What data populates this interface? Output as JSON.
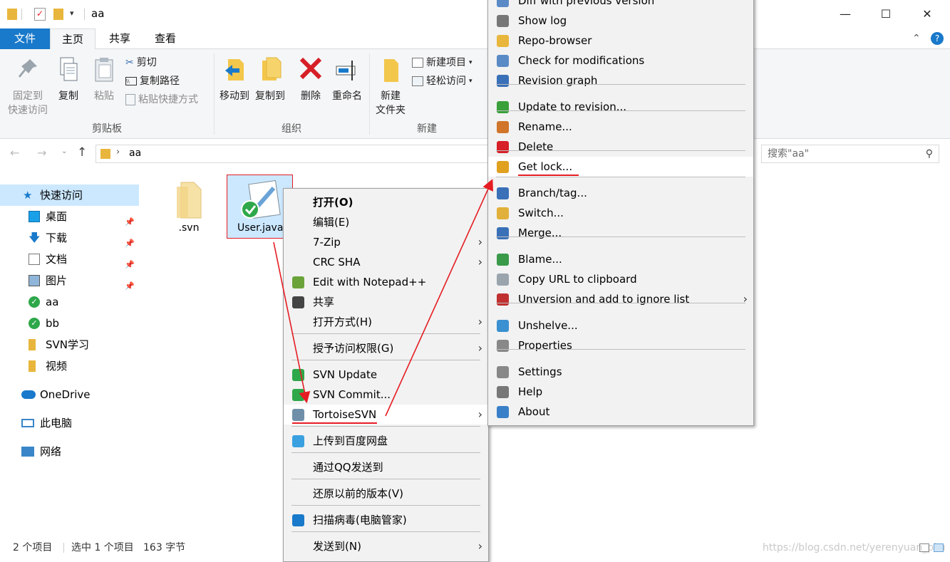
{
  "window": {
    "title": "aa",
    "minimize": "—",
    "maximize": "☐",
    "close": "✕"
  },
  "ribbon_tabs": [
    "文件",
    "主页",
    "共享",
    "查看"
  ],
  "ribbon": {
    "pin": "固定到\n快速访问",
    "pin_l1": "固定到",
    "pin_l2": "快速访问",
    "copy": "复制",
    "paste": "粘贴",
    "cut": "剪切",
    "copy_path": "复制路径",
    "paste_shortcut": "粘贴快捷方式",
    "clipboard_group": "剪贴板",
    "move_to": "移动到",
    "copy_to": "复制到",
    "delete": "删除",
    "rename": "重命名",
    "organize_group": "组织",
    "new_folder_l1": "新建",
    "new_folder_l2": "文件夹",
    "new_item": "新建项目",
    "easy_access": "轻松访问",
    "new_group": "新建"
  },
  "address": {
    "path": "aa",
    "search_placeholder": "搜索\"aa\""
  },
  "nav": {
    "quick_access": "快速访问",
    "items": [
      "桌面",
      "下载",
      "文档",
      "图片",
      "aa",
      "bb",
      "SVN学习",
      "视频"
    ],
    "onedrive": "OneDrive",
    "this_pc": "此电脑",
    "network": "网络"
  },
  "files": [
    {
      "name": ".svn"
    },
    {
      "name": "User.java"
    }
  ],
  "status": {
    "count": "2 个项目",
    "selected": "选中 1 个项目",
    "size": "163 字节"
  },
  "watermark": "https://blog.csdn.net/yerenyuan_pku",
  "context_menu": {
    "items": [
      {
        "label": "打开(O)",
        "bold": true
      },
      {
        "label": "编辑(E)"
      },
      {
        "label": "7-Zip",
        "submenu": true
      },
      {
        "label": "CRC SHA",
        "submenu": true
      },
      {
        "label": "Edit with Notepad++"
      },
      {
        "label": "共享"
      },
      {
        "label": "打开方式(H)",
        "submenu": true
      },
      {
        "label": "授予访问权限(G)",
        "submenu": true
      },
      {
        "label": "SVN Update"
      },
      {
        "label": "SVN Commit..."
      },
      {
        "label": "TortoiseSVN",
        "submenu": true
      },
      {
        "label": "上传到百度网盘"
      },
      {
        "label": "通过QQ发送到"
      },
      {
        "label": "还原以前的版本(V)"
      },
      {
        "label": "扫描病毒(电脑管家)"
      },
      {
        "label": "发送到(N)",
        "submenu": true
      }
    ]
  },
  "svn_menu": {
    "items": [
      {
        "label": "Diff with previous version"
      },
      {
        "label": "Show log"
      },
      {
        "label": "Repo-browser"
      },
      {
        "label": "Check for modifications"
      },
      {
        "label": "Revision graph"
      },
      {
        "label": "Update to revision..."
      },
      {
        "label": "Rename..."
      },
      {
        "label": "Delete"
      },
      {
        "label": "Get lock..."
      },
      {
        "label": "Branch/tag..."
      },
      {
        "label": "Switch..."
      },
      {
        "label": "Merge..."
      },
      {
        "label": "Blame..."
      },
      {
        "label": "Copy URL to clipboard"
      },
      {
        "label": "Unversion and add to ignore list",
        "submenu": true
      },
      {
        "label": "Unshelve..."
      },
      {
        "label": "Properties"
      },
      {
        "label": "Settings"
      },
      {
        "label": "Help"
      },
      {
        "label": "About"
      }
    ]
  },
  "colors": {
    "accent": "#1979ca",
    "selection": "#cce8ff",
    "annotation": "#e51c23"
  }
}
